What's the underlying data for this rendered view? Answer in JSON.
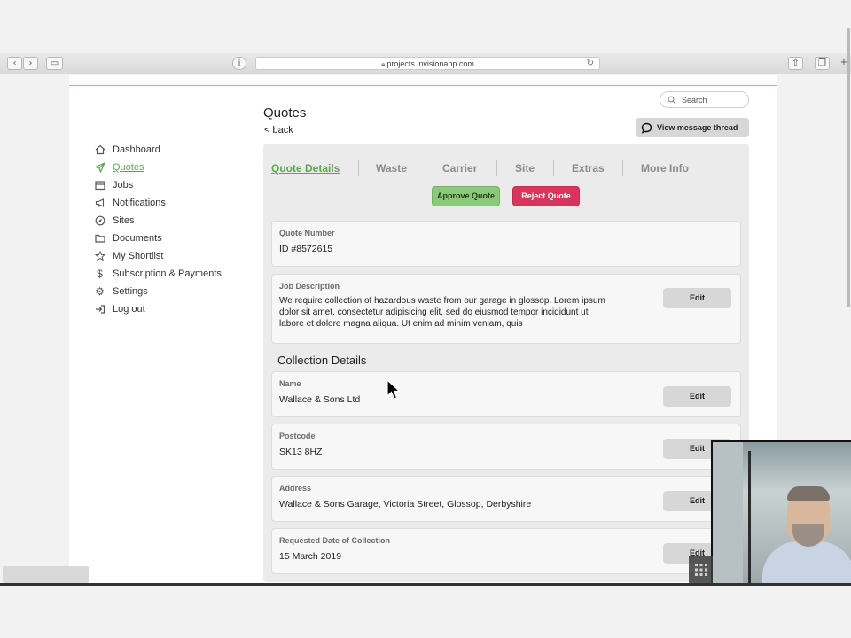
{
  "browser": {
    "url": "projects.invisionapp.com"
  },
  "sidebar": {
    "items": [
      {
        "label": "Dashboard",
        "icon": "home-icon",
        "active": false
      },
      {
        "label": "Quotes",
        "icon": "paper-plane-icon",
        "active": true
      },
      {
        "label": "Jobs",
        "icon": "briefcase-icon",
        "active": false
      },
      {
        "label": "Notifications",
        "icon": "megaphone-icon",
        "active": false
      },
      {
        "label": "Sites",
        "icon": "compass-icon",
        "active": false
      },
      {
        "label": "Documents",
        "icon": "folder-icon",
        "active": false
      },
      {
        "label": "My Shortlist",
        "icon": "star-icon",
        "active": false
      },
      {
        "label": "Subscription & Payments",
        "icon": "dollar-icon",
        "active": false
      },
      {
        "label": "Settings",
        "icon": "gear-icon",
        "active": false
      },
      {
        "label": "Log out",
        "icon": "logout-icon",
        "active": false
      }
    ]
  },
  "header": {
    "search_placeholder": "Search",
    "title": "Quotes",
    "back_label": "< back",
    "message_button": "View message thread"
  },
  "tabs": [
    "Quote Details",
    "Waste",
    "Carrier",
    "Site",
    "Extras",
    "More Info"
  ],
  "actions": {
    "approve": "Approve Quote",
    "reject": "Reject Quote"
  },
  "quote": {
    "number_label": "Quote Number",
    "number_value": "ID #8572615"
  },
  "job": {
    "label": "Job Description",
    "value": "We require collection of hazardous waste from our garage in glossop. Lorem ipsum dolor sit amet, consectetur adipisicing elit, sed do eiusmod tempor incididunt ut labore et dolore magna aliqua. Ut enim ad minim veniam, quis",
    "edit": "Edit"
  },
  "collection": {
    "title": "Collection Details",
    "fields": [
      {
        "label": "Name",
        "value": "Wallace & Sons Ltd",
        "edit": "Edit"
      },
      {
        "label": "Postcode",
        "value": "SK13 8HZ",
        "edit": "Edit"
      },
      {
        "label": "Address",
        "value": "Wallace & Sons Garage, Victoria Street, Glossop, Derbyshire",
        "edit": "Edit"
      },
      {
        "label": "Requested Date of Collection",
        "value": "15 March 2019",
        "edit": "Edit"
      }
    ]
  },
  "colors": {
    "accent": "#5aa84c",
    "approve": "#8bc97a",
    "reject": "#d9345c",
    "panel": "#ebebeb"
  }
}
